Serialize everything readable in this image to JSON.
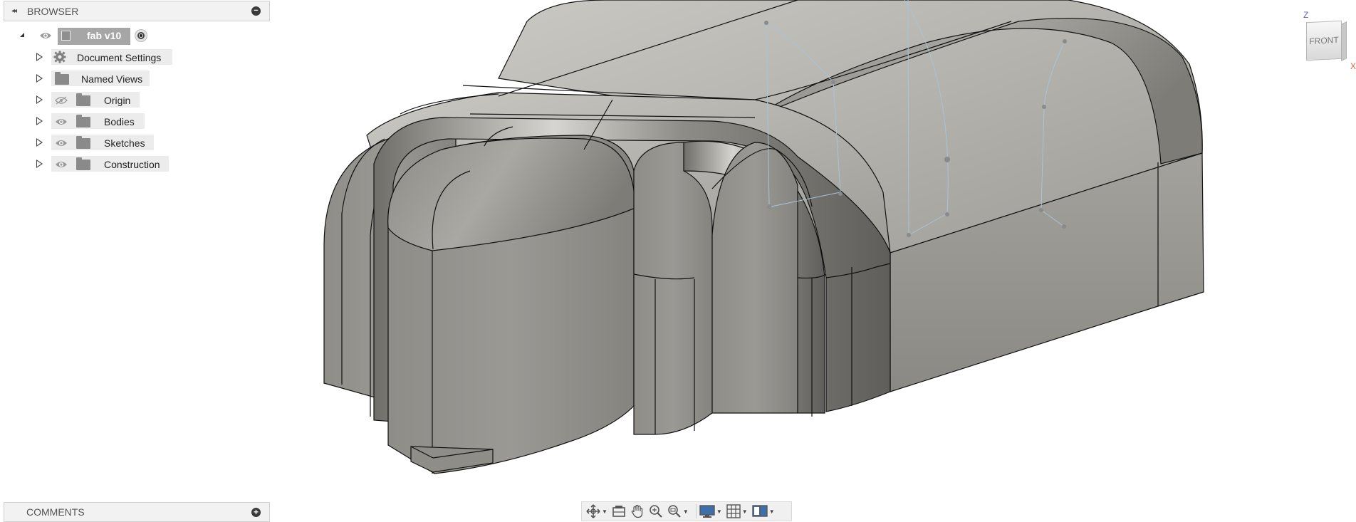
{
  "browser": {
    "title": "BROWSER",
    "collapse_glyph": "◂◂",
    "minimize_glyph": "−",
    "root": {
      "label": "fab v10"
    },
    "items": [
      {
        "label": "Document Settings",
        "icon": "gear-icon"
      },
      {
        "label": "Named Views",
        "icon": "folder-icon"
      },
      {
        "label": "Origin",
        "icon": "folder-icon",
        "visibility": "hidden-eye-icon"
      },
      {
        "label": "Bodies",
        "icon": "folder-icon",
        "visibility": "eye-icon"
      },
      {
        "label": "Sketches",
        "icon": "folder-icon",
        "visibility": "eye-icon"
      },
      {
        "label": "Construction",
        "icon": "folder-icon",
        "visibility": "eye-icon"
      }
    ]
  },
  "comments": {
    "title": "COMMENTS",
    "add_glyph": "+"
  },
  "toolbar": {
    "buttons": [
      {
        "name": "orbit",
        "icon": "orbit-icon",
        "has_dropdown": true
      },
      {
        "name": "look-at",
        "icon": "look-at-icon",
        "has_dropdown": false
      },
      {
        "name": "pan",
        "icon": "hand-icon",
        "has_dropdown": false
      },
      {
        "name": "zoom",
        "icon": "zoom-icon",
        "has_dropdown": false
      },
      {
        "name": "zoom-window",
        "icon": "zoom-window-icon",
        "has_dropdown": true
      },
      {
        "name": "display-settings",
        "icon": "display-icon",
        "has_dropdown": true
      },
      {
        "name": "grid-settings",
        "icon": "grid-icon",
        "has_dropdown": true
      },
      {
        "name": "viewports",
        "icon": "viewports-icon",
        "has_dropdown": true
      }
    ]
  },
  "viewcube": {
    "face": "FRONT",
    "axis_z": "Z",
    "axis_x": "X"
  },
  "colors": {
    "model_body": "#8c8b86",
    "model_edge": "#111111",
    "panel_bg": "#f2f2f2",
    "root_highlight": "#a6a6a6"
  }
}
